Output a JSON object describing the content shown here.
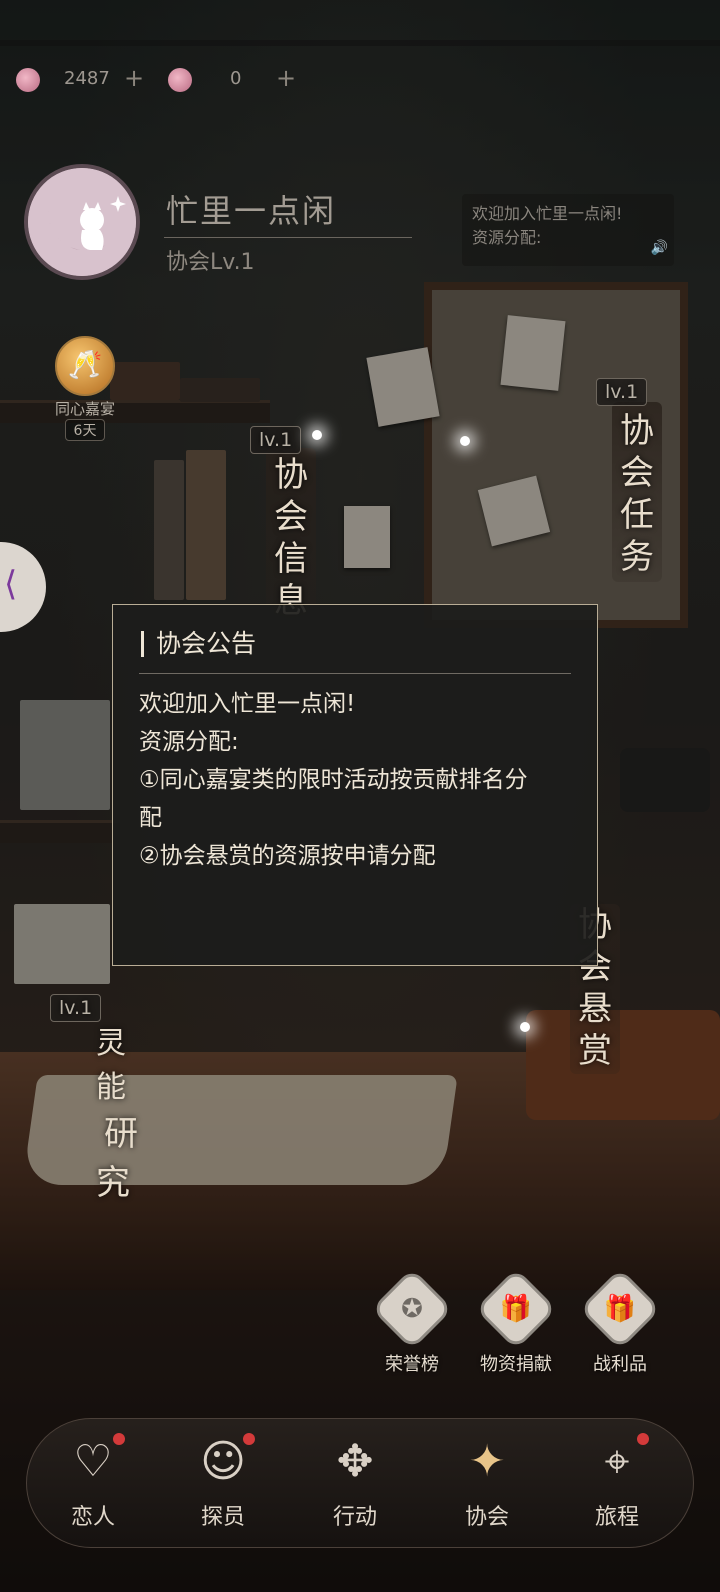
{
  "resources": [
    {
      "icon": "pink-gem-icon",
      "value": "2487"
    },
    {
      "icon": "pink-heart-coin-icon",
      "value": "0"
    }
  ],
  "guild": {
    "name": "忙里一点闲",
    "level": "协会Lv.1"
  },
  "notice_preview": {
    "line1": "欢迎加入忙里一点闲!",
    "line2": "资源分配:"
  },
  "event": {
    "name": "同心嘉宴",
    "days": "6天"
  },
  "facilities": {
    "info": {
      "level": "lv.1",
      "label": "协会信息"
    },
    "task": {
      "level": "lv.1",
      "label": "协会任务"
    },
    "bounty": {
      "label": "协会悬赏"
    },
    "research": {
      "level": "lv.1",
      "label_a": "灵能",
      "label_b": "研究"
    }
  },
  "announcement": {
    "title": "协会公告",
    "lines": [
      "欢迎加入忙里一点闲!",
      "资源分配:",
      "①同心嘉宴类的限时活动按贡献排名分",
      "配",
      "②协会悬赏的资源按申请分配"
    ]
  },
  "functions": [
    {
      "label": "荣誉榜",
      "icon": "medal-icon"
    },
    {
      "label": "物资捐献",
      "icon": "gift-hand-icon"
    },
    {
      "label": "战利品",
      "icon": "gift-box-icon"
    }
  ],
  "nav": [
    {
      "label": "恋人",
      "icon": "hearts-icon",
      "badge": true
    },
    {
      "label": "探员",
      "icon": "agent-icon",
      "badge": true
    },
    {
      "label": "行动",
      "icon": "cards-icon",
      "badge": false
    },
    {
      "label": "协会",
      "icon": "guild-emblem-icon",
      "badge": false,
      "active": true
    },
    {
      "label": "旅程",
      "icon": "map-pin-icon",
      "badge": true
    }
  ]
}
